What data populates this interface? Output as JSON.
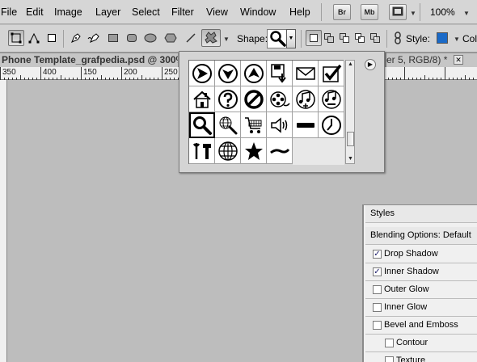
{
  "menubar": {
    "items": [
      "File",
      "Edit",
      "Image",
      "Layer",
      "Select",
      "Filter",
      "View",
      "Window",
      "Help"
    ],
    "bridge_label": "Br",
    "minibridge_label": "Mb",
    "zoom_value": "100%"
  },
  "options_bar": {
    "shape_label": "Shape:",
    "style_label": "Style:",
    "color_label": "Col",
    "style_color": "#1a6ac8"
  },
  "doc_tabs": {
    "active_title": "Phone Template_grafpedia.psd @ 300%",
    "other_title": "er 5, RGB/8) *",
    "close_symbol": "✕"
  },
  "ruler": {
    "labels": [
      "350",
      "400",
      "150",
      "200",
      "250"
    ]
  },
  "shape_picker": {
    "shapes": [
      "arrow-right-circle-icon",
      "arrow-down-circle-icon",
      "arrow-up-circle-icon",
      "disk-arrow-icon",
      "envelope-icon",
      "checkmark-box-icon",
      "house-icon",
      "question-circle-icon",
      "prohibited-icon",
      "film-reel-icon",
      "music-add-icon",
      "music-minus-icon",
      "magnifier-icon",
      "globe-search-icon",
      "shopping-cart-icon",
      "speaker-icon",
      "bar-icon",
      "clock-icon",
      "tools-icon",
      "globe-icon",
      "star-icon",
      "wave-icon"
    ],
    "selected_index": 12
  },
  "styles_panel": {
    "title": "Styles",
    "blending_label": "Blending Options: Default",
    "effects": [
      {
        "label": "Drop Shadow",
        "checked": true,
        "indent": false
      },
      {
        "label": "Inner Shadow",
        "checked": true,
        "indent": false
      },
      {
        "label": "Outer Glow",
        "checked": false,
        "indent": false
      },
      {
        "label": "Inner Glow",
        "checked": false,
        "indent": false
      },
      {
        "label": "Bevel and Emboss",
        "checked": false,
        "indent": false
      },
      {
        "label": "Contour",
        "checked": false,
        "indent": true
      },
      {
        "label": "Texture",
        "checked": false,
        "indent": true
      }
    ]
  }
}
